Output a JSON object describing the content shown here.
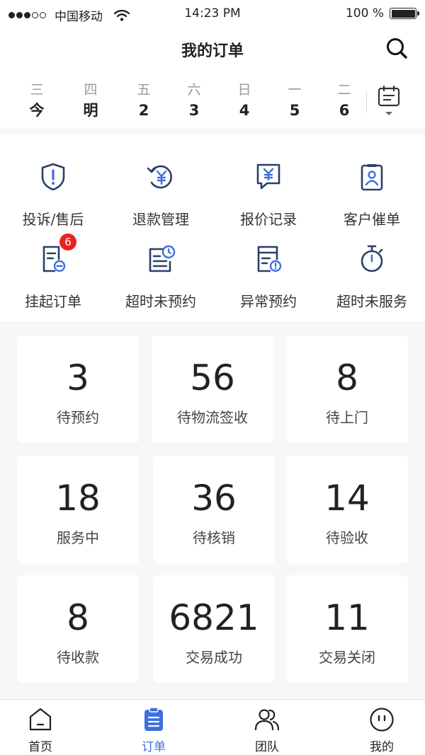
{
  "status_bar": {
    "carrier": "中国移动",
    "time": "14:23 PM",
    "battery": "100 %"
  },
  "header": {
    "title": "我的订单",
    "search_icon": "search-icon"
  },
  "date_strip": {
    "days": [
      {
        "weekday": "三",
        "day": "今"
      },
      {
        "weekday": "四",
        "day": "明"
      },
      {
        "weekday": "五",
        "day": "2"
      },
      {
        "weekday": "六",
        "day": "3"
      },
      {
        "weekday": "日",
        "day": "4"
      },
      {
        "weekday": "一",
        "day": "5"
      },
      {
        "weekday": "二",
        "day": "6"
      }
    ],
    "calendar_icon": "calendar-icon"
  },
  "quick_actions": [
    {
      "label": "投诉/售后",
      "icon": "shield-alert-icon"
    },
    {
      "label": "退款管理",
      "icon": "refund-icon"
    },
    {
      "label": "报价记录",
      "icon": "quote-icon"
    },
    {
      "label": "客户催单",
      "icon": "customer-badge-icon"
    },
    {
      "label": "挂起订单",
      "icon": "suspend-order-icon",
      "badge": "6"
    },
    {
      "label": "超时未预约",
      "icon": "timeout-schedule-icon"
    },
    {
      "label": "异常预约",
      "icon": "abnormal-schedule-icon"
    },
    {
      "label": "超时未服务",
      "icon": "stopwatch-icon"
    }
  ],
  "stats": [
    {
      "value": "3",
      "label": "待预约"
    },
    {
      "value": "56",
      "label": "待物流签收"
    },
    {
      "value": "8",
      "label": "待上门"
    },
    {
      "value": "18",
      "label": "服务中"
    },
    {
      "value": "36",
      "label": "待核销"
    },
    {
      "value": "14",
      "label": "待验收"
    },
    {
      "value": "8",
      "label": "待收款"
    },
    {
      "value": "6821",
      "label": "交易成功"
    },
    {
      "value": "11",
      "label": "交易关闭"
    }
  ],
  "tab_bar": {
    "tabs": [
      {
        "label": "首页",
        "icon": "home-icon"
      },
      {
        "label": "订单",
        "icon": "order-clipboard-icon",
        "active": true
      },
      {
        "label": "团队",
        "icon": "team-icon"
      },
      {
        "label": "我的",
        "icon": "profile-face-icon"
      }
    ]
  },
  "colors": {
    "accent": "#3e6fe0",
    "icon_navy": "#2b3f6b",
    "badge": "#e8231f"
  }
}
